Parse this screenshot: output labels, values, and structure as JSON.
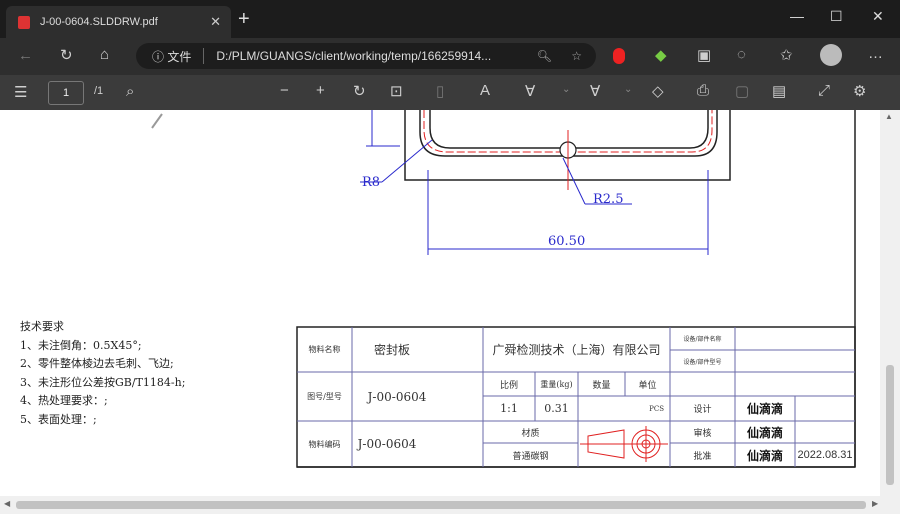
{
  "browser": {
    "tab_title": "J-00-0604.SLDDRW.pdf",
    "address_label": "文件",
    "url": "D:/PLM/GUANGS/client/working/temp/166259914...",
    "window_controls": [
      "minimize",
      "maximize",
      "close"
    ]
  },
  "pdf_toolbar": {
    "page_current": "1",
    "page_total": "/1"
  },
  "drawing": {
    "dims": {
      "r8": "R8",
      "r25": "R2.5",
      "width": "60.50"
    },
    "tech_requirements": [
      "技术要求",
      "1、未注倒角：0.5X45°;",
      "2、零件整体棱边去毛刺、飞边;",
      "3、未注形位公差按GB/T1184-h;",
      "4、热处理要求：;",
      "5、表面处理：;"
    ],
    "title_block": {
      "name_label": "物料名称",
      "name_value": "密封板",
      "company": "广舜检测技术（上海）有限公司",
      "equip_name_label": "设备/部件名称",
      "equip_model_label": "设备/部件型号",
      "drawing_no_label": "图号/型号",
      "drawing_no_value": "J-00-0604",
      "scale_label": "比例",
      "weight_label": "重量(kg)",
      "qty_label": "数量",
      "unit_label": "单位",
      "scale_value": "1:1",
      "weight_value": "0.31",
      "unit_value": "PCS",
      "design_label": "设计",
      "check_label": "审核",
      "approve_label": "批准",
      "code_label": "物料编码",
      "code_value": "J-00-0604",
      "material_label": "材质",
      "material_value": "普通碳钢",
      "signature": "仙滴滴",
      "date": "2022.08.31"
    },
    "colors": {
      "dimension": "#2a2acc",
      "centerline": "#e02020",
      "frame": "#222222",
      "table_lines": "#6a6aa8"
    }
  }
}
